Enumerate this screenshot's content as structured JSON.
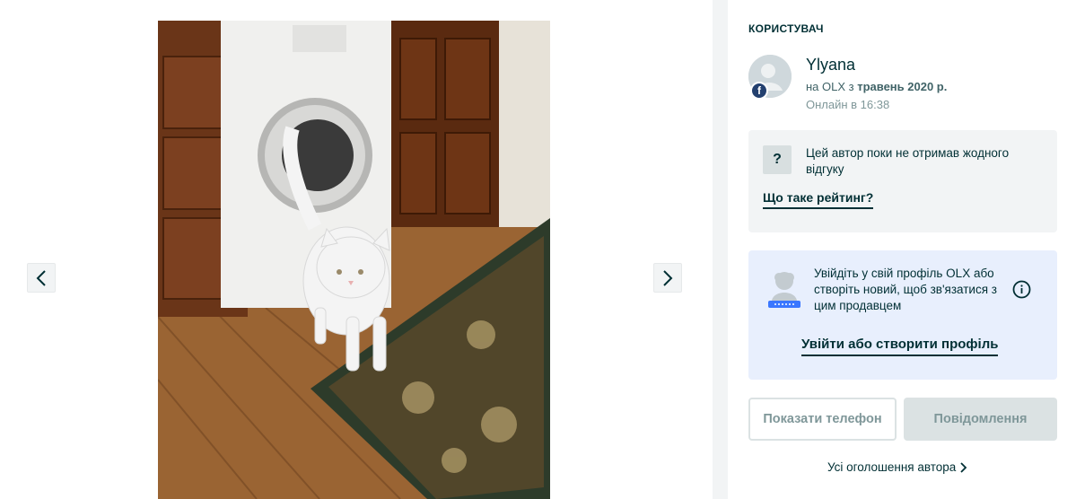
{
  "gallery": {
    "photo_alt": "",
    "prev_icon": "chevron-left-icon",
    "next_icon": "chevron-right-icon"
  },
  "seller": {
    "section_title": "КОРИСТУВАЧ",
    "name": "Ylyana",
    "since_prefix": "на OLX з ",
    "since_date": "травень 2020 р.",
    "online": "Онлайн в 16:38",
    "avatar_badge": "f"
  },
  "rating": {
    "icon": "?",
    "text": "Цей автор поки не отримав жодного відгуку",
    "link": "Що таке рейтинг?"
  },
  "login_prompt": {
    "text": "Увійдіть у свій профіль OLX або створіть новий, щоб зв'язатися з цим продавцем",
    "link": "Увійти або створити профіль"
  },
  "actions": {
    "show_phone": "Показати телефон",
    "message": "Повідомлення",
    "all_ads": "Усі оголошення автора"
  },
  "colors": {
    "text_primary": "#002f34",
    "rating_bg": "#f2f4f5",
    "login_bg": "#e8effd",
    "disabled_text": "#7f9799"
  }
}
